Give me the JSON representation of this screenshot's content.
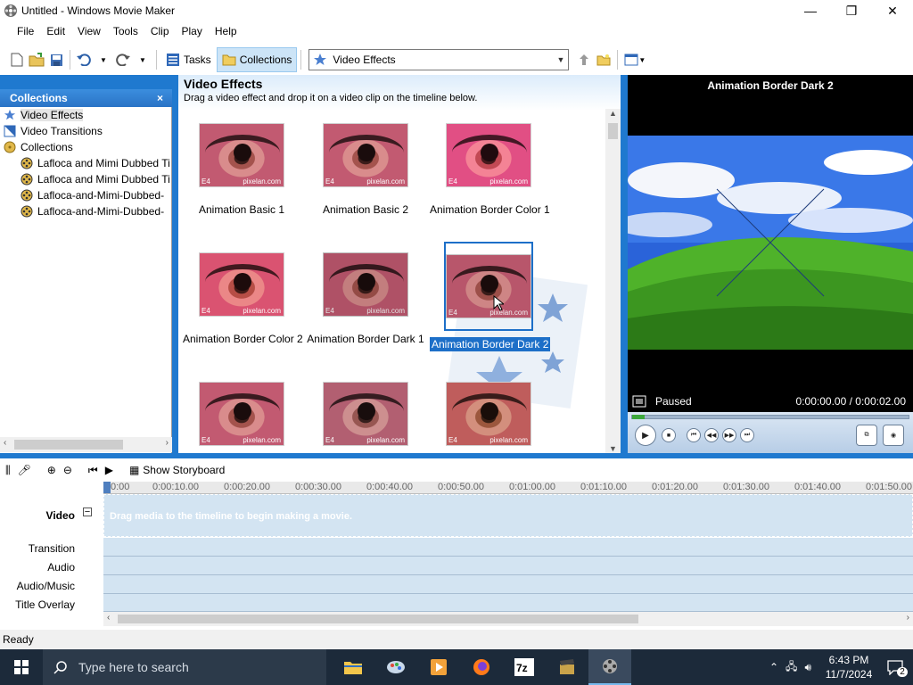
{
  "window": {
    "title": "Untitled - Windows Movie Maker",
    "min_icon": "minimize-icon",
    "max_icon": "maximize-icon",
    "close_icon": "close-icon"
  },
  "menu": [
    "File",
    "Edit",
    "View",
    "Tools",
    "Clip",
    "Play",
    "Help"
  ],
  "toolbar": {
    "tasks_label": "Tasks",
    "collections_label": "Collections",
    "dropdown_value": "Video Effects"
  },
  "collections_pane": {
    "title": "Collections",
    "close": "×",
    "items": [
      {
        "label": "Video Effects",
        "icon": "star-icon",
        "indent": 0,
        "selected": true
      },
      {
        "label": "Video Transitions",
        "icon": "transition-icon",
        "indent": 0,
        "selected": false
      },
      {
        "label": "Collections",
        "icon": "film-reel-icon",
        "indent": 0,
        "selected": false
      },
      {
        "label": "Lafloca and Mimi Dubbed Ti",
        "icon": "film-reel-icon",
        "indent": 1,
        "selected": false
      },
      {
        "label": "Lafloca and Mimi Dubbed Ti",
        "icon": "film-reel-icon",
        "indent": 1,
        "selected": false
      },
      {
        "label": "Lafloca-and-Mimi-Dubbed-",
        "icon": "film-reel-icon",
        "indent": 1,
        "selected": false
      },
      {
        "label": "Lafloca-and-Mimi-Dubbed-",
        "icon": "film-reel-icon",
        "indent": 1,
        "selected": false
      }
    ]
  },
  "effects": {
    "title": "Video Effects",
    "subtitle": "Drag a video effect and drop it on a video clip on the timeline below.",
    "watermark_tag": "E4",
    "watermark_site": "pixelan.com",
    "tiles": [
      {
        "label": "Animation Basic 1",
        "selected": false
      },
      {
        "label": "Animation Basic 2",
        "selected": false
      },
      {
        "label": "Animation Border Color 1",
        "selected": false
      },
      {
        "label": "Animation Border Color 2",
        "selected": false
      },
      {
        "label": "Animation Border Dark 1",
        "selected": false
      },
      {
        "label": "Animation Border Dark 2",
        "selected": true
      },
      {
        "label": "",
        "selected": false
      },
      {
        "label": "",
        "selected": false
      },
      {
        "label": "",
        "selected": false
      }
    ]
  },
  "preview": {
    "title": "Animation Border Dark 2",
    "status": "Paused",
    "time": "0:00:00.00 / 0:00:02.00",
    "seek_fraction": 0.0
  },
  "timeline": {
    "show_storyboard": "Show Storyboard",
    "tracks": [
      "Video",
      "Transition",
      "Audio",
      "Audio/Music",
      "Title Overlay"
    ],
    "video_hint": "Drag media to the timeline to begin making a movie.",
    "ruler_ticks": [
      "0:00",
      "0:00:10.00",
      "0:00:20.00",
      "0:00:30.00",
      "0:00:40.00",
      "0:00:50.00",
      "0:01:00.00",
      "0:01:10.00",
      "0:01:20.00",
      "0:01:30.00",
      "0:01:40.00",
      "0:01:50.00"
    ]
  },
  "status_bar": {
    "text": "Ready"
  },
  "taskbar": {
    "search_placeholder": "Type here to search",
    "time": "6:43 PM",
    "date": "11/7/2024",
    "notification_count": "2"
  }
}
